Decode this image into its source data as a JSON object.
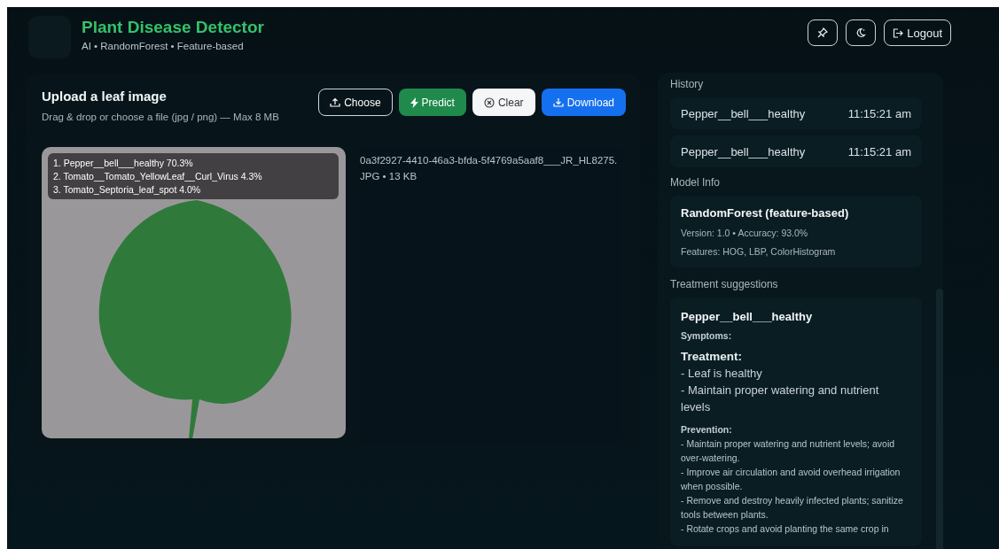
{
  "header": {
    "title": "Plant Disease Detector",
    "subtitle": "AI • RandomForest • Feature-based",
    "buttons": [
      {
        "kind": "pin"
      },
      {
        "kind": "moon"
      },
      {
        "kind": "logout",
        "label": "Logout"
      }
    ]
  },
  "upload": {
    "title": "Upload a leaf image",
    "hint": "Drag & drop or choose a file (jpg / png) — Max 8 MB",
    "buttons": [
      {
        "kind": "choose",
        "label": "Choose"
      },
      {
        "kind": "predict",
        "label": "Predict"
      },
      {
        "kind": "clear",
        "label": "Clear"
      },
      {
        "kind": "download",
        "label": "Download"
      }
    ],
    "predictions": [
      "1. Pepper__bell___healthy 70.3%",
      "2. Tomato__Tomato_YellowLeaf__Curl_Virus 4.3%",
      "3. Tomato_Septoria_leaf_spot 4.0%"
    ],
    "file_info": "0a3f2927-4410-46a3-bfda-5f4769a5aaf8___JR_HL8275.JPG • 13 KB"
  },
  "sidebar": {
    "history_title": "History",
    "history": [
      {
        "name": "Pepper__bell___healthy",
        "time": "11:15:21 am"
      },
      {
        "name": "Pepper__bell___healthy",
        "time": "11:15:21 am"
      }
    ],
    "model_title": "Model Info",
    "model": {
      "name": "RandomForest (feature-based)",
      "version": "Version: 1.0 • Accuracy: 93.0%",
      "features": "Features: HOG, LBP, ColorHistogram"
    },
    "treatment_title": "Treatment suggestions",
    "treatment": {
      "disease": "Pepper__bell___healthy",
      "symptoms_label": "Symptoms:",
      "treatment_label": "Treatment:",
      "treatment_lines": [
        "- Leaf is healthy",
        "- Maintain proper watering and nutrient levels"
      ],
      "prevention_label": "Prevention:",
      "prevention_lines": [
        "- Maintain proper watering and nutrient levels; avoid over-watering.",
        "- Improve air circulation and avoid overhead irrigation when possible.",
        "- Remove and destroy heavily infected plants; sanitize tools between plants.",
        "- Rotate crops and avoid planting the same crop in"
      ]
    }
  }
}
